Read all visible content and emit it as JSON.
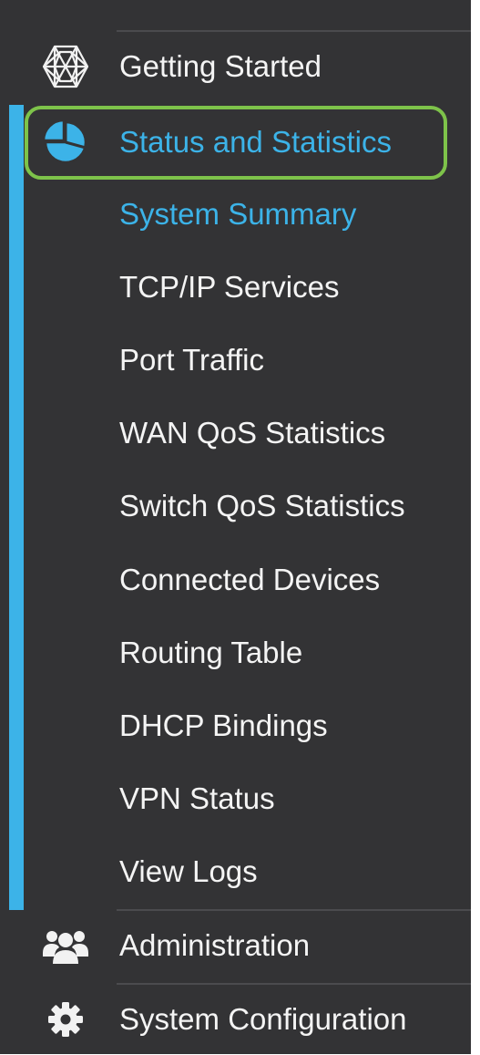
{
  "nav": {
    "getting_started": {
      "label": "Getting Started",
      "icon": "globe-wireframe-icon"
    },
    "status_and_statistics": {
      "label": "Status and Statistics",
      "icon": "pie-chart-icon",
      "active": true,
      "subitems": [
        {
          "label": "System Summary",
          "current": true
        },
        {
          "label": "TCP/IP Services"
        },
        {
          "label": "Port Traffic"
        },
        {
          "label": "WAN QoS Statistics"
        },
        {
          "label": "Switch QoS Statistics"
        },
        {
          "label": "Connected Devices"
        },
        {
          "label": "Routing Table"
        },
        {
          "label": "DHCP Bindings"
        },
        {
          "label": "VPN Status"
        },
        {
          "label": "View Logs"
        }
      ]
    },
    "administration": {
      "label": "Administration",
      "icon": "users-icon"
    },
    "system_configuration": {
      "label": "System Configuration",
      "icon": "gear-icon"
    }
  },
  "colors": {
    "panel_bg": "#333335",
    "accent": "#3cb3e8",
    "highlight_border": "#7ec34a",
    "text": "#f4f4f4"
  }
}
